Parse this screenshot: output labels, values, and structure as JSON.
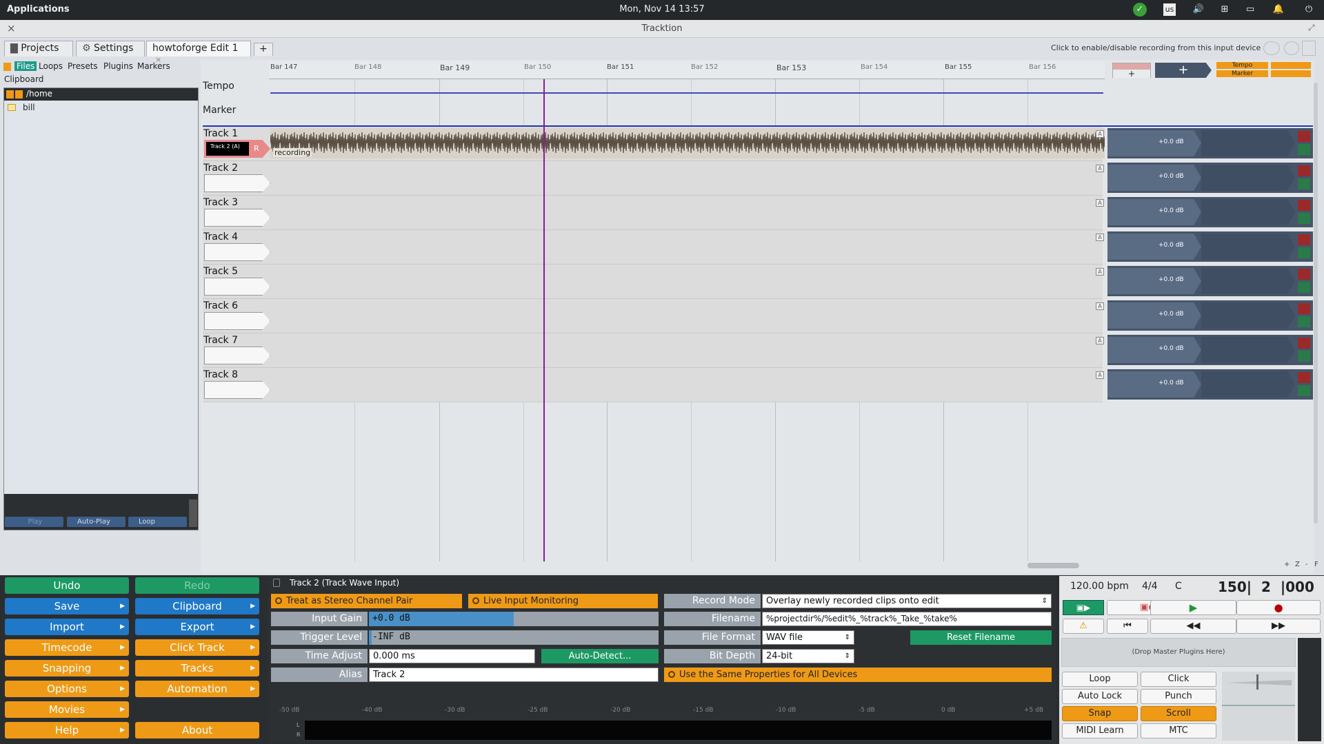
{
  "topbar": {
    "applications": "Applications",
    "clock": "Mon, Nov 14   13:57",
    "keyboard": "us"
  },
  "window": {
    "title": "Tracktion",
    "close": "×"
  },
  "tabs": {
    "projects": "Projects",
    "settings": "Settings",
    "edit": "howtoforge Edit 1",
    "add": "+"
  },
  "hint": "Click to enable/disable recording from this input device",
  "browser": {
    "tabs": [
      "Files",
      "Loops",
      "Presets",
      "Plugins",
      "Markers"
    ],
    "clipboard": "Clipboard",
    "path": "/home",
    "items": [
      "bill"
    ],
    "footer": {
      "play": "Play",
      "autoplay": "Auto-Play",
      "loop": "Loop"
    }
  },
  "ruler": {
    "bars": [
      "Bar 147",
      "Bar 148",
      "Bar 149",
      "Bar 150",
      "Bar 151",
      "Bar 152",
      "Bar 153",
      "Bar 154",
      "Bar 155",
      "Bar 156"
    ]
  },
  "globals": {
    "tempo": "Tempo",
    "marker": "Marker",
    "tempo_btn": "Tempo",
    "marker_btn": "Marker"
  },
  "tracks": [
    {
      "name": "Track 1",
      "gain": "+0.0 dB"
    },
    {
      "name": "Track 2",
      "gain": "+0.0 dB"
    },
    {
      "name": "Track 3",
      "gain": "+0.0 dB"
    },
    {
      "name": "Track 4",
      "gain": "+0.0 dB"
    },
    {
      "name": "Track 5",
      "gain": "+0.0 dB"
    },
    {
      "name": "Track 6",
      "gain": "+0.0 dB"
    },
    {
      "name": "Track 7",
      "gain": "+0.0 dB"
    },
    {
      "name": "Track 8",
      "gain": "+0.0 dB"
    }
  ],
  "track1_input": {
    "label": "Track 2 (A)",
    "r": "R",
    "recording": "recording"
  },
  "zoom": {
    "plus": "+",
    "z": "Z",
    "minus": "-",
    "f": "F"
  },
  "left_buttons": {
    "undo": "Undo",
    "redo": "Redo",
    "save": "Save",
    "clipboard": "Clipboard",
    "import": "Import",
    "export": "Export",
    "timecode": "Timecode",
    "click_track": "Click Track",
    "snapping": "Snapping",
    "tracks": "Tracks",
    "options": "Options",
    "automation": "Automation",
    "movies": "Movies",
    "help": "Help",
    "about": "About"
  },
  "input_props": {
    "title": "Track 2 (Track Wave Input)",
    "stereo": "Treat as Stereo Channel Pair",
    "monitoring": "Live Input Monitoring",
    "input_gain_label": "Input Gain",
    "input_gain": "+0.0 dB",
    "trigger_label": "Trigger Level",
    "trigger": "-INF dB",
    "time_adjust_label": "Time Adjust",
    "time_adjust": "0.000 ms",
    "auto_detect": "Auto-Detect...",
    "alias_label": "Alias",
    "alias": "Track 2",
    "record_mode_label": "Record Mode",
    "record_mode": "Overlay newly recorded clips onto edit",
    "filename_label": "Filename",
    "filename": "%projectdir%/%edit%_%track%_Take_%take%",
    "format_label": "File Format",
    "format": "WAV file",
    "reset": "Reset Filename",
    "depth_label": "Bit Depth",
    "depth": "24-bit",
    "same_props": "Use the Same Properties for All Devices",
    "meter_ticks": [
      "-50 dB",
      "-40 dB",
      "-30 dB",
      "-25 dB",
      "-20 dB",
      "-15 dB",
      "-10 dB",
      "-5 dB",
      "0 dB",
      "+5 dB"
    ],
    "meter_l": "L",
    "meter_r": "R"
  },
  "transport": {
    "bpm": "120.00 bpm",
    "sig": "4/4",
    "key": "C",
    "position": "150|  2  |000",
    "master_plugins": "(Drop Master Plugins Here)",
    "buttons": [
      "Loop",
      "Click",
      "Auto Lock",
      "Punch",
      "Snap",
      "Scroll",
      "MIDI Learn",
      "MTC"
    ]
  }
}
